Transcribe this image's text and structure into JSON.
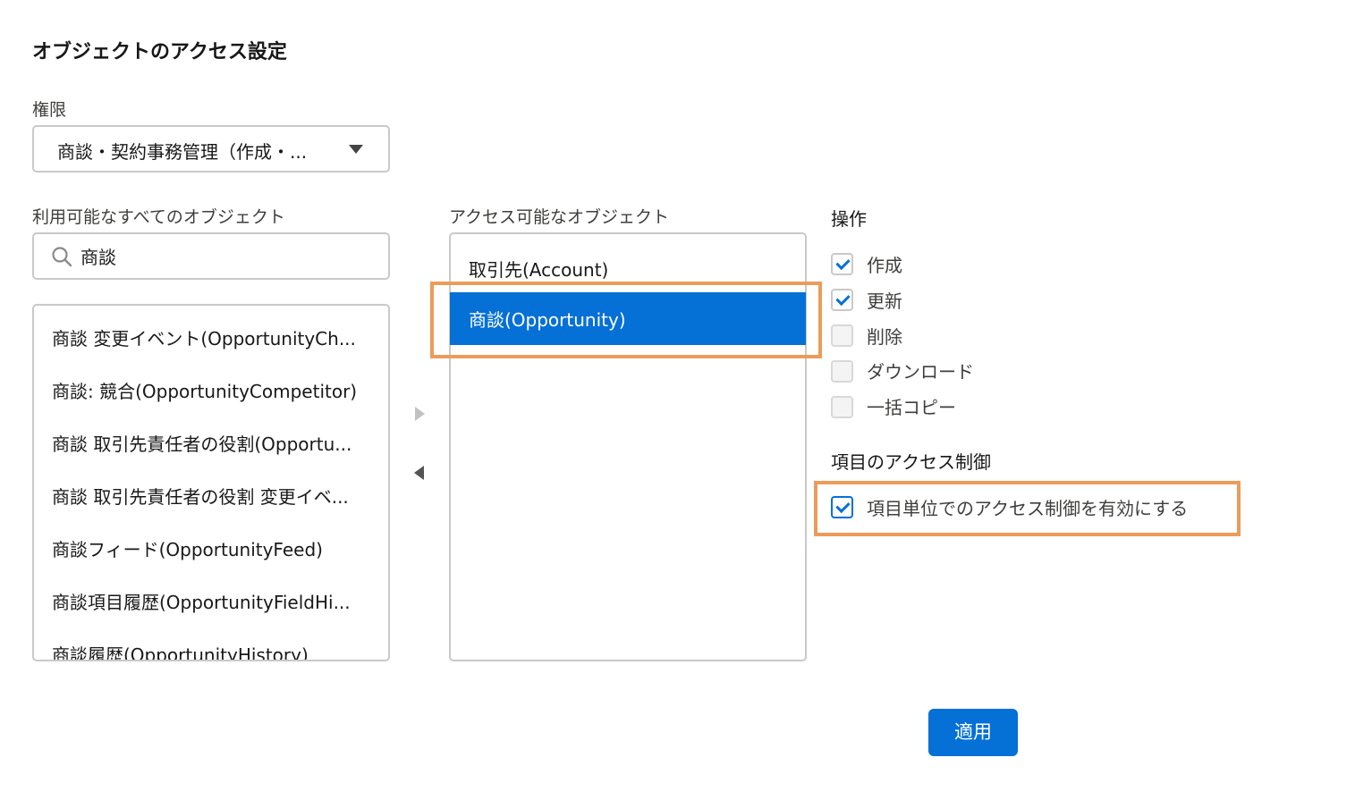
{
  "page_title": "オブジェクトのアクセス設定",
  "permission": {
    "label": "権限",
    "selected": "商談・契約事務管理（作成・..."
  },
  "available": {
    "label": "利用可能なすべてのオブジェクト",
    "search_value": "商談",
    "items": [
      "商談 変更イベント(OpportunityCh...",
      "商談: 競合(OpportunityCompetitor)",
      "商談 取引先責任者の役割(Opportu...",
      "商談 取引先責任者の役割 変更イベ...",
      "商談フィード(OpportunityFeed)",
      "商談項目履歴(OpportunityFieldHi...",
      "商談履歴(OpportunityHistory)"
    ]
  },
  "accessible": {
    "label": "アクセス可能なオブジェクト",
    "items": [
      "取引先(Account)",
      "商談(Opportunity)"
    ]
  },
  "operations": {
    "label": "操作",
    "items": [
      {
        "label": "作成",
        "checked": true
      },
      {
        "label": "更新",
        "checked": true
      },
      {
        "label": "削除",
        "checked": false
      },
      {
        "label": "ダウンロード",
        "checked": false
      },
      {
        "label": "一括コピー",
        "checked": false
      }
    ]
  },
  "field_access": {
    "label": "項目のアクセス制御",
    "option_label": "項目単位でのアクセス制御を有効にする",
    "checked": true
  },
  "apply_label": "適用",
  "colors": {
    "accent": "#0570d6",
    "highlight": "#ec9b5a"
  },
  "icons": {
    "search": "search-icon",
    "dropdown": "chevron-down-icon",
    "move_right": "arrow-right-icon",
    "move_left": "arrow-left-icon",
    "check": "check-icon"
  }
}
